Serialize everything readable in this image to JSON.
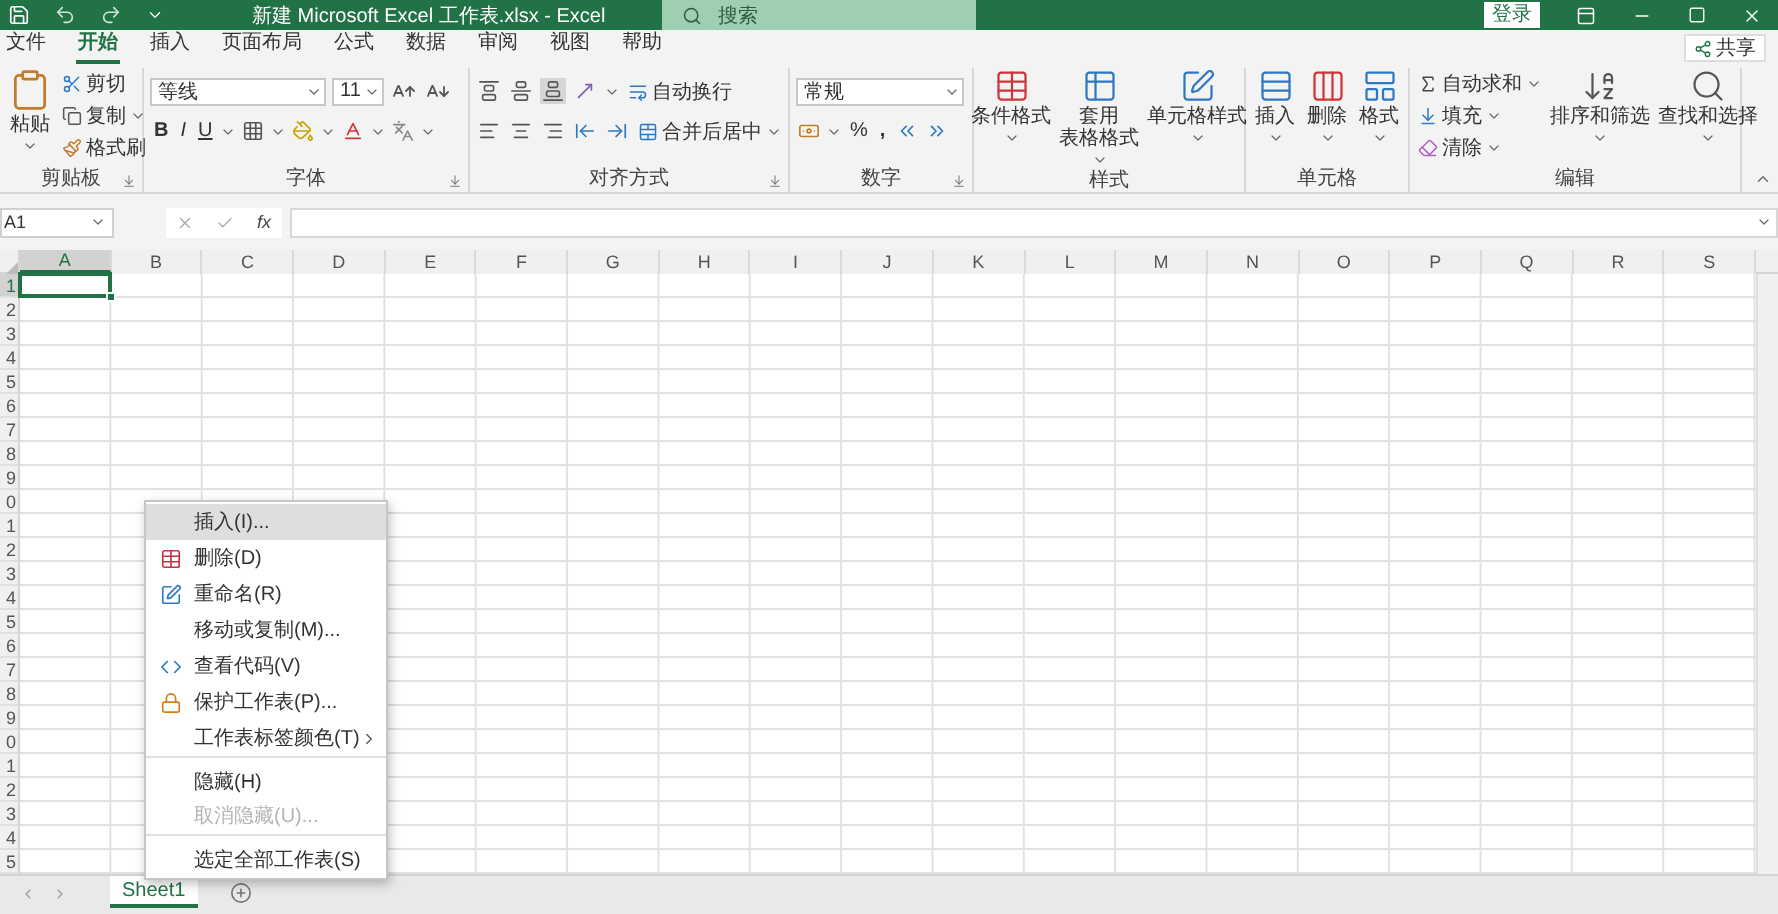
{
  "title_bar": {
    "title": "新建 Microsoft Excel 工作表.xlsx  -  Excel",
    "search": {
      "placeholder": "搜索"
    },
    "sign_in": "登录"
  },
  "menu_tabs": [
    {
      "label": "文件",
      "selected": false
    },
    {
      "label": "开始",
      "selected": true
    },
    {
      "label": "插入",
      "selected": false
    },
    {
      "label": "页面布局",
      "selected": false
    },
    {
      "label": "公式",
      "selected": false
    },
    {
      "label": "数据",
      "selected": false
    },
    {
      "label": "审阅",
      "selected": false
    },
    {
      "label": "视图",
      "selected": false
    },
    {
      "label": "帮助",
      "selected": false
    }
  ],
  "share": "共享",
  "ribbon": {
    "clipboard": {
      "label": "剪贴板",
      "paste": "粘贴",
      "items": [
        "剪切",
        "复制",
        "格式刷"
      ]
    },
    "font": {
      "label": "字体",
      "font": "等线",
      "size": "11",
      "styles": [
        "B",
        "I",
        "U"
      ]
    },
    "alignment": {
      "label": "对齐方式",
      "wrap": "自动换行",
      "merge": "合并后居中"
    },
    "number": {
      "label": "数字",
      "format": "常规",
      "percent": "%",
      "comma": ","
    },
    "styles": {
      "label": "样式",
      "buttons": [
        [
          "条件格式"
        ],
        [
          "套用",
          "表格格式"
        ],
        [
          "单元格样式"
        ]
      ]
    },
    "cells": {
      "label": "单元格",
      "buttons": [
        "插入",
        "删除",
        "格式"
      ]
    },
    "editing": {
      "label": "编辑",
      "items": [
        "自动求和",
        "填充",
        "清除"
      ],
      "buttons": [
        "排序和筛选",
        "查找和选择"
      ]
    }
  },
  "formula_bar": {
    "name_box": "A1",
    "function_label": "fx"
  },
  "sheet": {
    "columns": [
      {
        "label": "A",
        "selected": true
      },
      {
        "label": "B",
        "selected": false
      },
      {
        "label": "C",
        "selected": false
      },
      {
        "label": "D",
        "selected": false
      },
      {
        "label": "E",
        "selected": false
      },
      {
        "label": "F",
        "selected": false
      },
      {
        "label": "G",
        "selected": false
      },
      {
        "label": "H",
        "selected": false
      },
      {
        "label": "I",
        "selected": false
      },
      {
        "label": "J",
        "selected": false
      },
      {
        "label": "K",
        "selected": false
      },
      {
        "label": "L",
        "selected": false
      },
      {
        "label": "M",
        "selected": false
      },
      {
        "label": "N",
        "selected": false
      },
      {
        "label": "O",
        "selected": false
      },
      {
        "label": "P",
        "selected": false
      },
      {
        "label": "Q",
        "selected": false
      },
      {
        "label": "R",
        "selected": false
      },
      {
        "label": "S",
        "selected": false
      }
    ],
    "rows": [
      {
        "label": "1",
        "selected": true
      },
      {
        "label": "2",
        "selected": false
      },
      {
        "label": "3",
        "selected": false
      },
      {
        "label": "4",
        "selected": false
      },
      {
        "label": "5",
        "selected": false
      },
      {
        "label": "6",
        "selected": false
      },
      {
        "label": "7",
        "selected": false
      },
      {
        "label": "8",
        "selected": false
      },
      {
        "label": "9",
        "selected": false
      },
      {
        "label": "0",
        "selected": false
      },
      {
        "label": "1",
        "selected": false
      },
      {
        "label": "2",
        "selected": false
      },
      {
        "label": "3",
        "selected": false
      },
      {
        "label": "4",
        "selected": false
      },
      {
        "label": "5",
        "selected": false
      },
      {
        "label": "6",
        "selected": false
      },
      {
        "label": "7",
        "selected": false
      },
      {
        "label": "8",
        "selected": false
      },
      {
        "label": "9",
        "selected": false
      },
      {
        "label": "0",
        "selected": false
      },
      {
        "label": "1",
        "selected": false
      },
      {
        "label": "2",
        "selected": false
      },
      {
        "label": "3",
        "selected": false
      },
      {
        "label": "4",
        "selected": false
      },
      {
        "label": "5",
        "selected": false
      }
    ]
  },
  "sheet_tabs": [
    {
      "label": "Sheet1",
      "selected": true
    }
  ],
  "context_menu": [
    {
      "label": "插入(I)...",
      "highlighted": true,
      "disabled": false,
      "submenu": false,
      "separator_before": false
    },
    {
      "label": "删除(D)",
      "highlighted": false,
      "disabled": false,
      "submenu": false,
      "separator_before": false
    },
    {
      "label": "重命名(R)",
      "highlighted": false,
      "disabled": false,
      "submenu": false,
      "separator_before": false
    },
    {
      "label": "移动或复制(M)...",
      "highlighted": false,
      "disabled": false,
      "submenu": false,
      "separator_before": false
    },
    {
      "label": "查看代码(V)",
      "highlighted": false,
      "disabled": false,
      "submenu": false,
      "separator_before": false
    },
    {
      "label": "保护工作表(P)...",
      "highlighted": false,
      "disabled": false,
      "submenu": false,
      "separator_before": false
    },
    {
      "label": "工作表标签颜色(T)",
      "highlighted": false,
      "disabled": false,
      "submenu": true,
      "separator_before": false
    },
    {
      "label": "隐藏(H)",
      "highlighted": false,
      "disabled": false,
      "submenu": false,
      "separator_before": true
    },
    {
      "label": "取消隐藏(U)...",
      "highlighted": false,
      "disabled": true,
      "submenu": false,
      "separator_before": false
    },
    {
      "label": "选定全部工作表(S)",
      "highlighted": false,
      "disabled": false,
      "submenu": false,
      "separator_before": true
    }
  ]
}
